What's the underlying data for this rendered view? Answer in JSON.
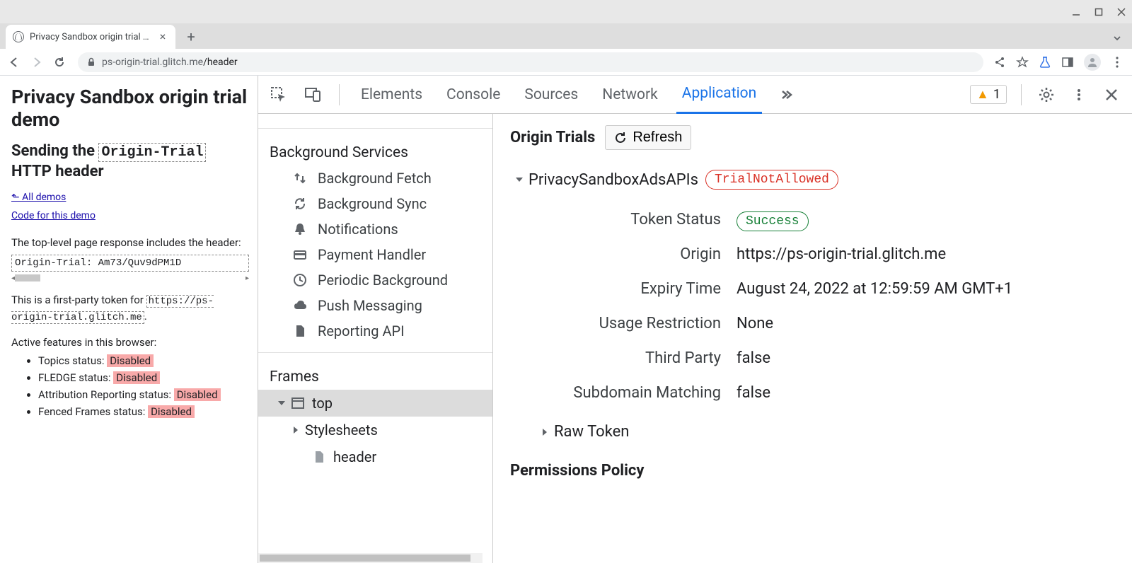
{
  "window": {
    "tab_title": "Privacy Sandbox origin trial de"
  },
  "url": {
    "host": "ps-origin-trial.glitch.me",
    "path": "/header"
  },
  "page": {
    "h1": "Privacy Sandbox origin trial demo",
    "h2_pre": "Sending the ",
    "h2_code": "Origin-Trial",
    "h2_post": " HTTP header",
    "link_all_demos": "⬑ All demos",
    "link_code": "Code for this demo",
    "p1": "The top-level page response includes the header:",
    "header_code": "Origin-Trial: Am73/Quv9dPM1D",
    "p2_pre": "This is a first-party token for ",
    "p2_code": "https://ps-origin-trial.glitch.me",
    "p2_post": ".",
    "p3": "Active features in this browser:",
    "features": [
      {
        "label": "Topics status: ",
        "badge": "Disabled"
      },
      {
        "label": "FLEDGE status: ",
        "badge": "Disabled"
      },
      {
        "label": "Attribution Reporting status: ",
        "badge": "Disabled"
      },
      {
        "label": "Fenced Frames status: ",
        "badge": "Disabled"
      }
    ]
  },
  "devtools": {
    "tabs": [
      "Elements",
      "Console",
      "Sources",
      "Network",
      "Application"
    ],
    "active_tab": "Application",
    "warning_count": "1",
    "sidebar": {
      "section_bg": "Background Services",
      "bg_items": [
        {
          "label": "Background Fetch",
          "icon": "updown"
        },
        {
          "label": "Background Sync",
          "icon": "sync"
        },
        {
          "label": "Notifications",
          "icon": "bell"
        },
        {
          "label": "Payment Handler",
          "icon": "card"
        },
        {
          "label": "Periodic Background",
          "icon": "clock"
        },
        {
          "label": "Push Messaging",
          "icon": "cloud"
        },
        {
          "label": "Reporting API",
          "icon": "file"
        }
      ],
      "section_frames": "Frames",
      "frame_top": "top",
      "frame_stylesheets": "Stylesheets",
      "frame_header": "header"
    },
    "detail": {
      "title": "Origin Trials",
      "refresh": "Refresh",
      "trial_name": "PrivacySandboxAdsAPIs",
      "trial_status": "TrialNotAllowed",
      "rows": [
        {
          "k": "Token Status",
          "v": "Success",
          "pill": "green"
        },
        {
          "k": "Origin",
          "v": "https://ps-origin-trial.glitch.me"
        },
        {
          "k": "Expiry Time",
          "v": "August 24, 2022 at 12:59:59 AM GMT+1"
        },
        {
          "k": "Usage Restriction",
          "v": "None"
        },
        {
          "k": "Third Party",
          "v": "false"
        },
        {
          "k": "Subdomain Matching",
          "v": "false"
        }
      ],
      "raw_token": "Raw Token",
      "permissions": "Permissions Policy"
    }
  }
}
